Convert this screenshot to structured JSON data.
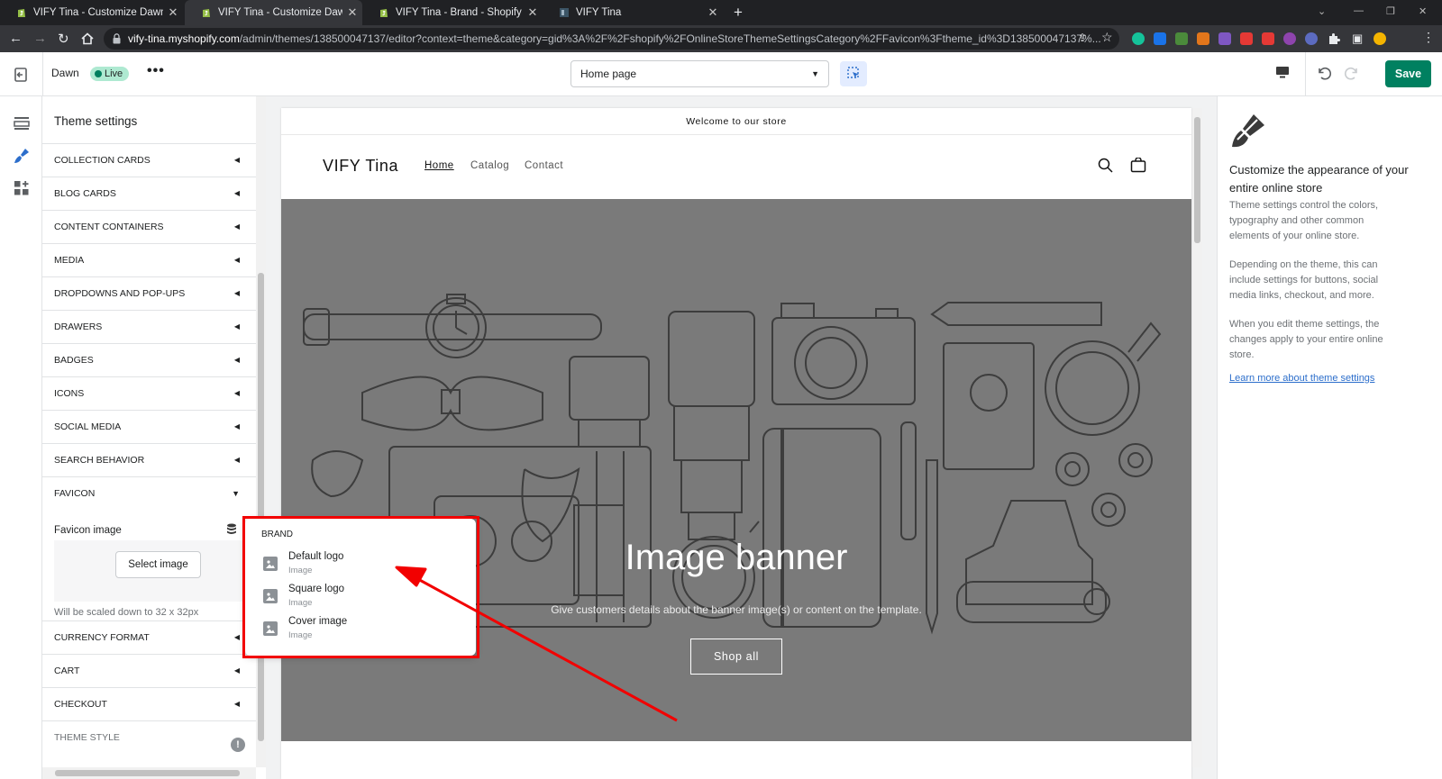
{
  "browser": {
    "tabs": [
      {
        "title": "VIFY Tina - Customize Dawn - Sho"
      },
      {
        "title": "VIFY Tina - Customize Dawn - Sho"
      },
      {
        "title": "VIFY Tina - Brand - Shopify"
      },
      {
        "title": "VIFY Tina"
      }
    ],
    "url_host": "vify-tina.myshopify.com",
    "url_path": "/admin/themes/138500047137/editor?context=theme&category=gid%3A%2F%2Fshopify%2FOnlineStoreThemeSettingsCategory%2FFavicon%3Ftheme_id%3D138500047137%..."
  },
  "topbar": {
    "theme_name": "Dawn",
    "live_badge": "Live",
    "page_select": "Home page",
    "save_label": "Save"
  },
  "settings_panel": {
    "title": "Theme settings",
    "sections": [
      "COLLECTION CARDS",
      "BLOG CARDS",
      "CONTENT CONTAINERS",
      "MEDIA",
      "DROPDOWNS AND POP-UPS",
      "DRAWERS",
      "BADGES",
      "ICONS",
      "SOCIAL MEDIA",
      "SEARCH BEHAVIOR",
      "FAVICON",
      "CURRENCY FORMAT",
      "CART",
      "CHECKOUT",
      "THEME STYLE"
    ],
    "favicon": {
      "label": "Favicon image",
      "select_button": "Select image",
      "help": "Will be scaled down to 32 x 32px"
    }
  },
  "popover": {
    "title": "BRAND",
    "items": [
      {
        "name": "Default logo",
        "type": "Image"
      },
      {
        "name": "Square logo",
        "type": "Image"
      },
      {
        "name": "Cover image",
        "type": "Image"
      }
    ]
  },
  "preview": {
    "announcement": "Welcome to our store",
    "logo": "VIFY Tina",
    "nav": [
      "Home",
      "Catalog",
      "Contact"
    ],
    "banner_title": "Image banner",
    "banner_subtitle": "Give customers details about the banner image(s) or content on the template.",
    "banner_button": "Shop all"
  },
  "info_panel": {
    "title": "Customize the appearance of your entire online store",
    "paragraphs": [
      "Theme settings control the colors, typography and other common elements of your online store.",
      "Depending on the theme, this can include settings for buttons, social media links, checkout, and more.",
      "When you edit theme settings, the changes apply to your entire online store."
    ],
    "link": "Learn more about theme settings"
  },
  "colors": {
    "save_green": "#008060",
    "annotation_red": "#f20000",
    "banner_gray": "#7a7a7a",
    "link_blue": "#2c6ecb"
  },
  "icons": [
    "exit-icon",
    "more-icon",
    "inspect-icon",
    "desktop-icon",
    "undo-icon",
    "redo-icon",
    "sections-icon",
    "theme-settings-icon",
    "apps-icon",
    "search-icon",
    "cart-icon",
    "paint-brush-icon",
    "database-icon",
    "image-icon"
  ]
}
